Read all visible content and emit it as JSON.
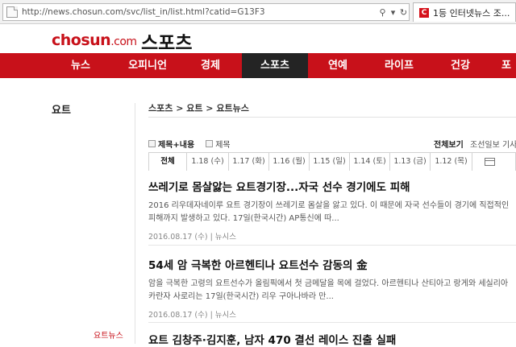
{
  "browser": {
    "url": "http://news.chosun.com/svc/list_in/list.html?catid=G13F3",
    "tab_title": "1등 인터넷뉴스 조...",
    "search_glyph": "⚲",
    "dropdown_glyph": "▾",
    "refresh_glyph": "↻",
    "tab_favicon_letter": "C"
  },
  "header": {
    "logo": "chosun",
    "logo_suffix": ".com",
    "section_title": "스포츠"
  },
  "nav": {
    "items": [
      {
        "label": "뉴스"
      },
      {
        "label": "오피니언"
      },
      {
        "label": "경제"
      },
      {
        "label": "스포츠"
      },
      {
        "label": "연예"
      },
      {
        "label": "라이프"
      },
      {
        "label": "건강"
      },
      {
        "label": "포"
      }
    ],
    "active_index": 3
  },
  "sidebar": {
    "title": "요트",
    "section_label": "요트뉴스"
  },
  "breadcrumb": "스포츠 > 요트 > 요트뉴스",
  "filters": {
    "option1": "제목+내용",
    "option2": "제목",
    "view_all": "전체보기",
    "source": "조선일보 기사만"
  },
  "date_tabs": [
    "전체",
    "1.18 (수)",
    "1.17 (화)",
    "1.16 (월)",
    "1.15 (일)",
    "1.14 (토)",
    "1.13 (금)",
    "1.12 (목)"
  ],
  "articles": [
    {
      "title": "쓰레기로 몸살앓는 요트경기장...자국 선수 경기에도 피해",
      "summary": "2016 리우데자네이루 요트 경기장이 쓰레기로 몸살을 앓고 있다. 이 때문에 자국 선수들이 경기에 직접적인 피해까지 발생하고 있다. 17일(한국시간) AP통신에 따...",
      "meta": "2016.08.17 (수) | 뉴시스"
    },
    {
      "title": "54세 암 극복한 아르헨티나 요트선수 감동의 金",
      "summary": "암을 극복한 고령의 요트선수가 올림픽에서 첫 금메달을 목에 걸었다. 아르헨티나 산티아고 랑게와 세실리아 카란자 사로리는 17일(한국시간) 리우 구아나바라 만...",
      "meta": "2016.08.17 (수) | 뉴시스"
    },
    {
      "title": "요트 김창주·김지훈, 남자 470 결선 레이스 진출 실패",
      "summary": "",
      "meta": ""
    }
  ],
  "colors": {
    "brand_red": "#c8111a",
    "nav_active": "#242424"
  }
}
